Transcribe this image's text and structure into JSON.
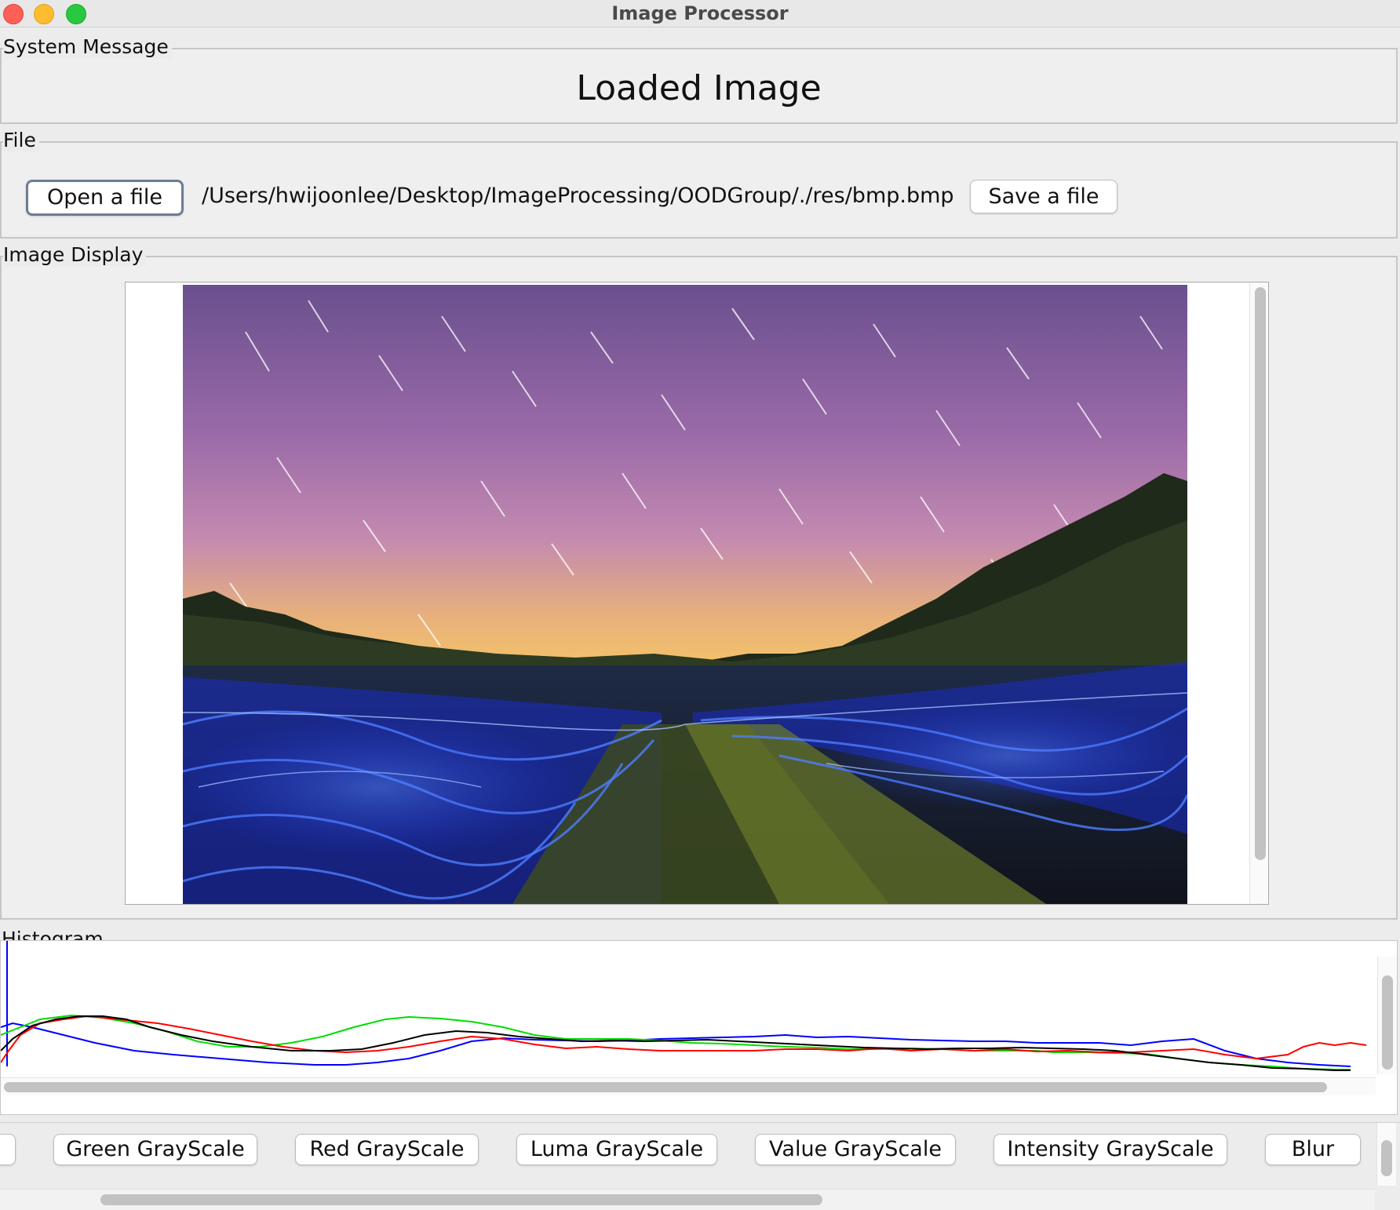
{
  "window": {
    "title": "Image Processor"
  },
  "system_message": {
    "legend": "System Message",
    "text": "Loaded Image"
  },
  "file": {
    "legend": "File",
    "open_label": "Open a file",
    "path": "/Users/hwijoonlee/Desktop/ImageProcessing/OODGroup/./res/bmp.bmp",
    "save_label": "Save a file"
  },
  "image_display": {
    "legend": "Image Display"
  },
  "histogram": {
    "legend": "Histogram",
    "colors": {
      "red": "#ff0000",
      "green": "#00dd00",
      "blue": "#0000ff",
      "luma": "#000000"
    }
  },
  "toolbar": {
    "buttons": [
      "Green GrayScale",
      "Red GrayScale",
      "Luma GrayScale",
      "Value GrayScale",
      "Intensity GrayScale",
      "Blur"
    ]
  }
}
